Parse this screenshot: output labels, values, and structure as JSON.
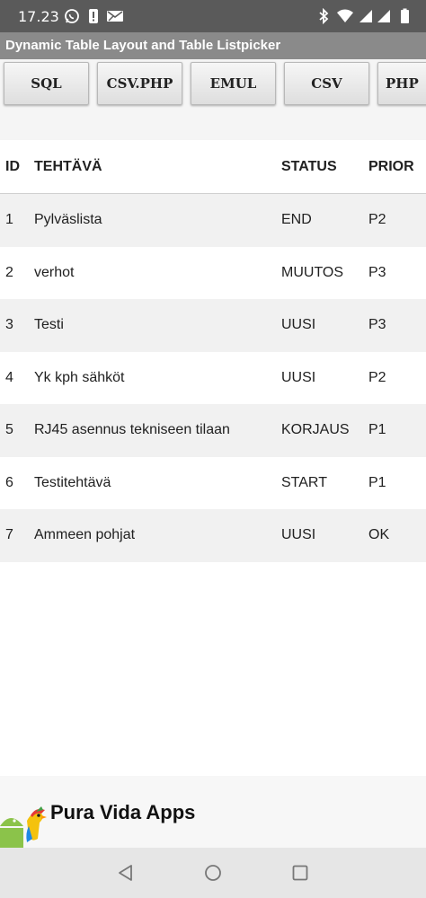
{
  "status_bar": {
    "time": "17.23"
  },
  "app": {
    "title": "Dynamic Table Layout and Table Listpicker"
  },
  "toolbar": {
    "buttons": [
      {
        "label": "SQL"
      },
      {
        "label": "CSV.PHP"
      },
      {
        "label": "EMUL"
      },
      {
        "label": "CSV"
      },
      {
        "label": "PHP"
      }
    ]
  },
  "table": {
    "columns": [
      "ID",
      "TEHTÄVÄ",
      "STATUS",
      "PRIOR"
    ],
    "rows": [
      {
        "id": "1",
        "task": "Pylväslista",
        "status": "END",
        "prior": "P2"
      },
      {
        "id": "2",
        "task": "verhot",
        "status": "MUUTOS",
        "prior": "P3"
      },
      {
        "id": "3",
        "task": "Testi",
        "status": "UUSI",
        "prior": "P3"
      },
      {
        "id": "4",
        "task": "Yk kph sähköt",
        "status": "UUSI",
        "prior": "P2"
      },
      {
        "id": "5",
        "task": "RJ45 asennus tekniseen tilaan",
        "status": "KORJAUS",
        "prior": "P1"
      },
      {
        "id": "6",
        "task": "Testitehtävä",
        "status": "START",
        "prior": "P1"
      },
      {
        "id": "7",
        "task": "Ammeen pohjat",
        "status": "UUSI",
        "prior": "OK"
      }
    ]
  },
  "footer": {
    "brand": "Pura Vida Apps"
  },
  "icons": {
    "status_left": [
      "whatsapp-icon",
      "notification-icon",
      "message-icon"
    ],
    "status_right": [
      "bluetooth-icon",
      "wifi-icon",
      "signal-icon",
      "signal-icon",
      "battery-icon"
    ],
    "nav": [
      "back-icon",
      "home-icon",
      "recents-icon"
    ]
  },
  "colors": {
    "status_bar": "#5a5a5a",
    "title_bar": "#8a8a8a",
    "row_alt": "#f1f1f1",
    "nav_bar": "#e6e6e6"
  }
}
